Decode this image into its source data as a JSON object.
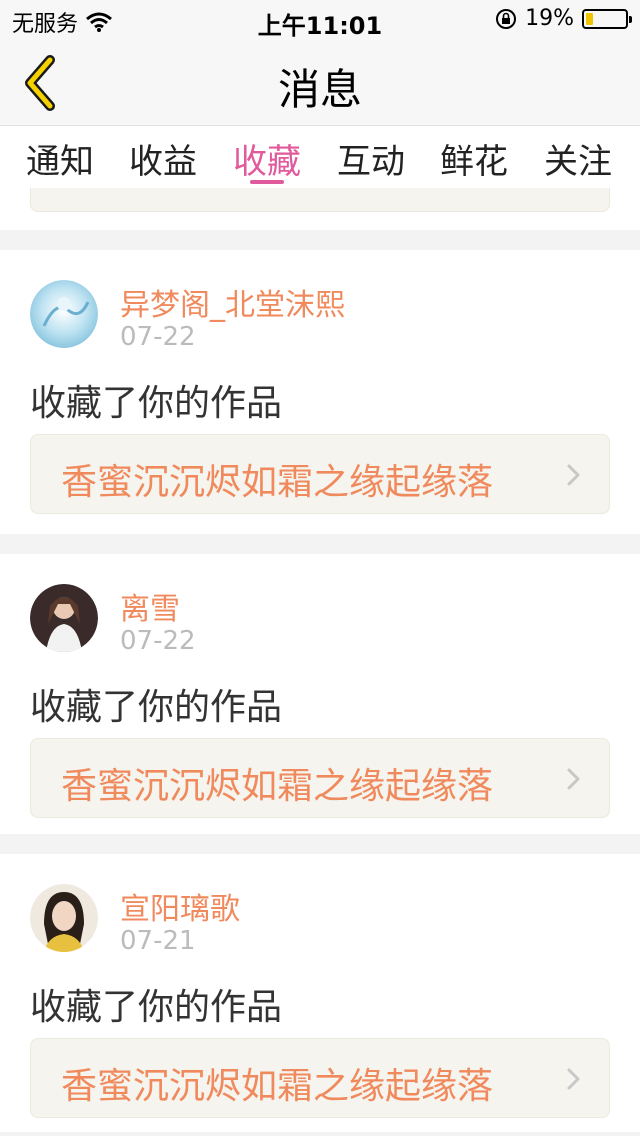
{
  "status_bar": {
    "carrier": "无服务",
    "time": "上午11:01",
    "battery_percent": "19%",
    "battery_level": 0.19,
    "icons": [
      "wifi-icon",
      "orientation-lock-icon",
      "battery-icon"
    ]
  },
  "nav": {
    "title": "消息",
    "back_icon": "chevron-left-icon"
  },
  "tabs": [
    {
      "label": "通知",
      "active": false
    },
    {
      "label": "收益",
      "active": false
    },
    {
      "label": "收藏",
      "active": true
    },
    {
      "label": "互动",
      "active": false
    },
    {
      "label": "鲜花",
      "active": false
    },
    {
      "label": "关注",
      "active": false
    }
  ],
  "messages": [
    {
      "username": "异梦阁_北堂沫熙",
      "date": "07-22",
      "action": "收藏了你的作品",
      "work_title": "香蜜沉沉烬如霜之缘起缘落"
    },
    {
      "username": "离雪",
      "date": "07-22",
      "action": "收藏了你的作品",
      "work_title": "香蜜沉沉烬如霜之缘起缘落"
    },
    {
      "username": "宣阳璃歌",
      "date": "07-21",
      "action": "收藏了你的作品",
      "work_title": "香蜜沉沉烬如霜之缘起缘落"
    }
  ],
  "colors": {
    "accent_pink": "#e05a9c",
    "username_orange": "#f08a5d",
    "back_yellow": "#f5d100"
  }
}
